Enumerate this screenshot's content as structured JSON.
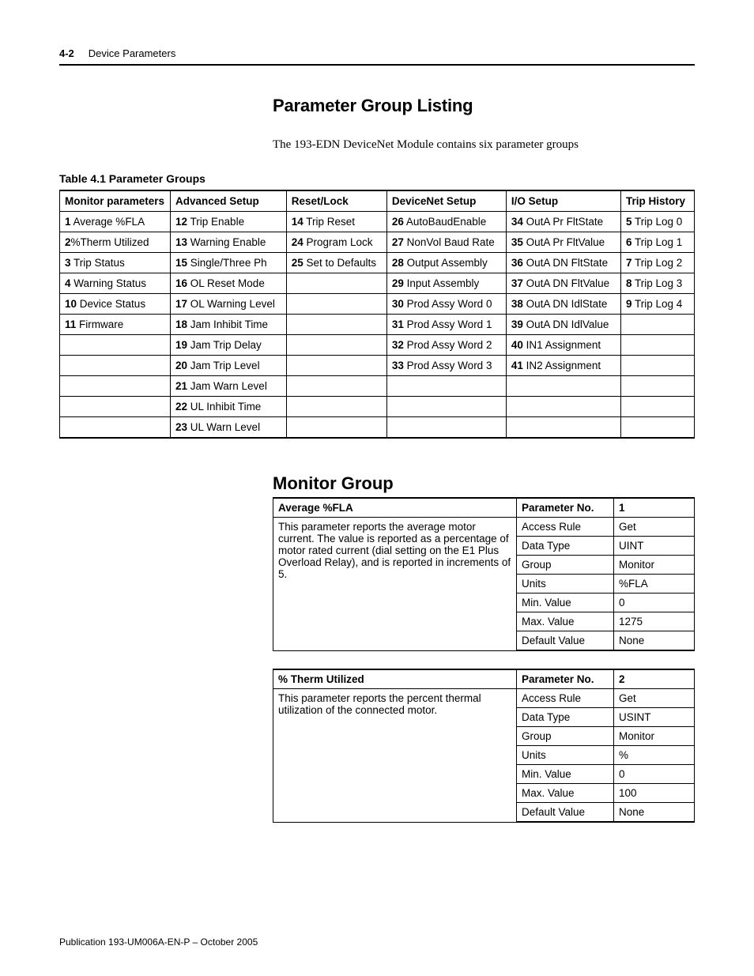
{
  "header": {
    "page_number": "4-2",
    "chapter": "Device Parameters"
  },
  "section1": {
    "title": "Parameter Group Listing",
    "intro": "The 193-EDN DeviceNet Module contains six parameter groups"
  },
  "table1": {
    "caption": "Table 4.1 Parameter Groups",
    "headers": [
      "Monitor parameters",
      "Advanced Setup",
      "Reset/Lock",
      "DeviceNet Setup",
      "I/O Setup",
      "Trip History"
    ],
    "rows": [
      [
        {
          "n": "1",
          "t": " Average %FLA"
        },
        {
          "n": "12",
          "t": " Trip Enable"
        },
        {
          "n": "14",
          "t": " Trip Reset"
        },
        {
          "n": "26",
          "t": " AutoBaudEnable"
        },
        {
          "n": "34",
          "t": " OutA Pr FltState"
        },
        {
          "n": "5",
          "t": " Trip Log 0"
        }
      ],
      [
        {
          "n": "2",
          "t": "%Therm Utilized"
        },
        {
          "n": "13",
          "t": " Warning Enable"
        },
        {
          "n": "24",
          "t": " Program Lock"
        },
        {
          "n": "27",
          "t": " NonVol Baud Rate"
        },
        {
          "n": "35",
          "t": " OutA Pr FltValue"
        },
        {
          "n": "6",
          "t": " Trip Log 1"
        }
      ],
      [
        {
          "n": "3",
          "t": " Trip Status"
        },
        {
          "n": "15",
          "t": " Single/Three Ph"
        },
        {
          "n": "25",
          "t": " Set to Defaults"
        },
        {
          "n": "28",
          "t": " Output Assembly"
        },
        {
          "n": "36",
          "t": " OutA DN FltState"
        },
        {
          "n": "7",
          "t": " Trip Log 2"
        }
      ],
      [
        {
          "n": "4",
          "t": " Warning Status"
        },
        {
          "n": "16",
          "t": " OL Reset Mode"
        },
        null,
        {
          "n": "29",
          "t": " Input Assembly"
        },
        {
          "n": "37",
          "t": " OutA DN FltValue"
        },
        {
          "n": "8",
          "t": " Trip Log 3"
        }
      ],
      [
        {
          "n": "10",
          "t": " Device Status"
        },
        {
          "n": "17",
          "t": " OL Warning Level"
        },
        null,
        {
          "n": "30",
          "t": " Prod Assy Word 0"
        },
        {
          "n": "38",
          "t": " OutA DN IdlState"
        },
        {
          "n": "9",
          "t": " Trip Log 4"
        }
      ],
      [
        {
          "n": "11",
          "t": " Firmware"
        },
        {
          "n": "18",
          "t": " Jam Inhibit Time"
        },
        null,
        {
          "n": "31",
          "t": " Prod Assy Word 1"
        },
        {
          "n": "39",
          "t": " OutA DN IdlValue"
        },
        null
      ],
      [
        null,
        {
          "n": "19",
          "t": " Jam Trip Delay"
        },
        null,
        {
          "n": "32",
          "t": " Prod Assy Word 2"
        },
        {
          "n": "40",
          "t": " IN1 Assignment"
        },
        null
      ],
      [
        null,
        {
          "n": "20",
          "t": " Jam Trip Level"
        },
        null,
        {
          "n": "33",
          "t": " Prod Assy Word 3"
        },
        {
          "n": "41",
          "t": " IN2 Assignment"
        },
        null
      ],
      [
        null,
        {
          "n": "21",
          "t": " Jam Warn Level"
        },
        null,
        null,
        null,
        null
      ],
      [
        null,
        {
          "n": "22",
          "t": " UL Inhibit Time"
        },
        null,
        null,
        null,
        null
      ],
      [
        null,
        {
          "n": "23",
          "t": " UL Warn Level"
        },
        null,
        null,
        null,
        null
      ]
    ]
  },
  "section2": {
    "title": "Monitor Group"
  },
  "detail_labels": {
    "param_no": "Parameter No.",
    "access_rule": "Access Rule",
    "data_type": "Data Type",
    "group": "Group",
    "units": "Units",
    "min": "Min. Value",
    "max": "Max. Value",
    "default": "Default Value"
  },
  "detail1": {
    "name": "Average %FLA",
    "desc": "This parameter reports the average motor current. The value is reported as a percentage of motor rated current (dial setting on the E1 Plus Overload Relay), and is reported in increments of 5.",
    "param_no": "1",
    "access_rule": "Get",
    "data_type": "UINT",
    "group": "Monitor",
    "units": "%FLA",
    "min": "0",
    "max": "1275",
    "default": "None"
  },
  "detail2": {
    "name": "% Therm Utilized",
    "desc": "This parameter reports the percent thermal utilization of the connected motor.",
    "param_no": "2",
    "access_rule": "Get",
    "data_type": "USINT",
    "group": "Monitor",
    "units": "%",
    "min": "0",
    "max": "100",
    "default": "None"
  },
  "footer": {
    "text": "Publication 193-UM006A-EN-P – October 2005"
  }
}
